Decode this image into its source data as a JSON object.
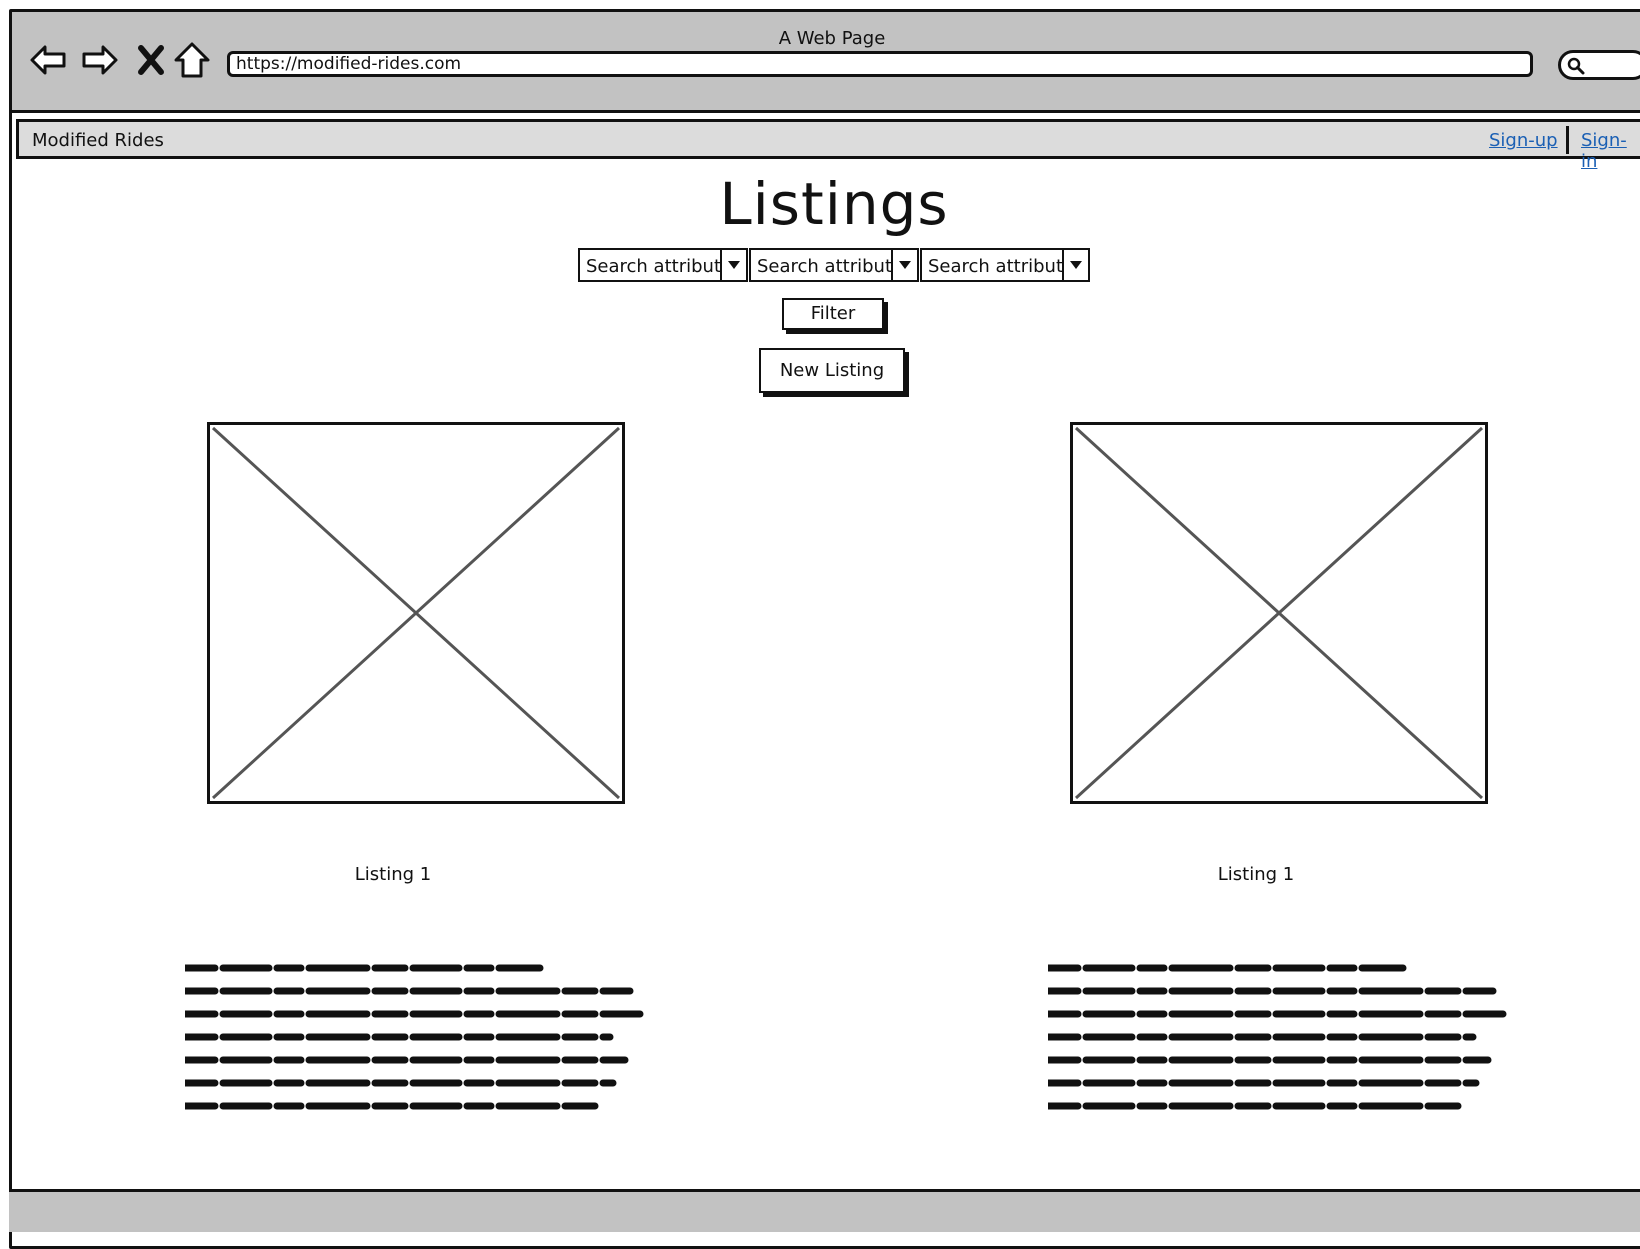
{
  "window": {
    "title": "A Web Page"
  },
  "browser": {
    "url": "https://modified-rides.com",
    "nav_icons": [
      "back-arrow-icon",
      "forward-arrow-icon",
      "close-x-icon",
      "home-icon"
    ],
    "search_icon": "magnifier-icon"
  },
  "header": {
    "brand": "Modified Rides",
    "links": {
      "signup": "Sign-up",
      "signin": "Sign-in"
    }
  },
  "main": {
    "title": "Listings",
    "filters": [
      {
        "value": "Search attribute"
      },
      {
        "value": "Search attribute"
      },
      {
        "value": "Search attribute"
      }
    ],
    "filter_button": "Filter",
    "new_listing_button": "New Listing"
  },
  "listings": [
    {
      "title": "Listing 1",
      "image": "image-placeholder-icon"
    },
    {
      "title": "Listing 1",
      "image": "image-placeholder-icon"
    }
  ],
  "colors": {
    "chrome": "#c2c2c2",
    "header_bg": "#dcdcdc",
    "link": "#1a5fb4",
    "stroke": "#111111"
  }
}
